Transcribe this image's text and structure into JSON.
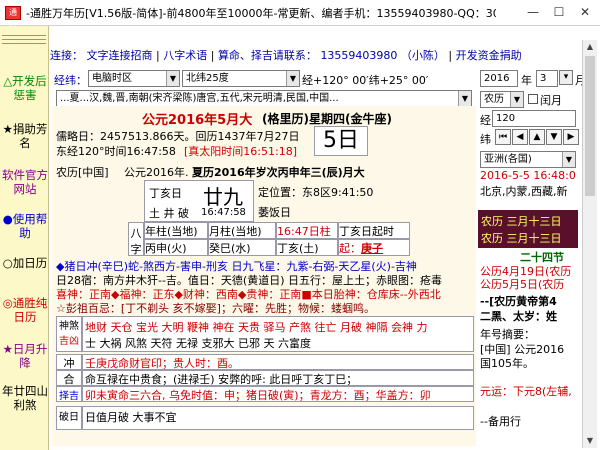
{
  "window": {
    "title": "-通胜万年历[V1.56版-简体]-前4800年至10000年-常更新、编者手机：13559403980-QQ：30...",
    "icon_text": "通胜",
    "min_label": "—",
    "max_label": "☐",
    "close_label": "✕"
  },
  "left_strip": {
    "items": [
      {
        "label": "△开发后惩害"
      },
      {
        "label": "★捐助芳名"
      },
      {
        "label": "软件官方网站"
      },
      {
        "label": "●使用帮助"
      },
      {
        "label": "○加日历"
      },
      {
        "label": "◎通胜纯日历"
      },
      {
        "label": "★日月升降"
      },
      {
        "label": "年廿四山利煞"
      }
    ]
  },
  "links": {
    "prefix": "连接：",
    "l1": "文字连接招商",
    "sep1": "|",
    "l2": "八字术语",
    "sep2": "|",
    "l3": "算命、择吉请联系：",
    "phone": "13559403980",
    "name": "（小陈）",
    "sep3": "|",
    "l4": "开发资金捐助"
  },
  "controls": {
    "jingwei_label": "经纬：",
    "timezone": "电脑时区",
    "lat": "北纬25度",
    "coords_text": "经+120° 00′纬+25° 00′",
    "dynasty": "...夏...汉,魏,晋,南朝(宋齐梁陈)唐宫,五代,宋元明清,民国,中国...",
    "year": "2016",
    "year_label": "年",
    "month": "3",
    "month_label": "月",
    "calendar_type": "农历",
    "leap_label": "闰月",
    "jing_label": "经",
    "jing_value": "120",
    "wei_label": "纬",
    "zone": "亚洲(各国)",
    "time_row": "2016-5-5 16:48:0",
    "location": "北京,内蒙,西藏,新"
  },
  "main": {
    "big_date": "公元2016年5月大",
    "weekday": "(格里历)星期四(金牛座)",
    "julian": "儒略日：2457513.866天。回历1437年7月27日",
    "true_solar": "东经120°时间16:47:58",
    "true_solar_red": "[真太阳时间16:51:18]",
    "day_num": "5日",
    "lunar_line_a": "农历[中国]",
    "lunar_line_b": "公元2016年.",
    "lunar_line_c": "夏历2016年岁次丙申年三(辰)月大",
    "day_gz": "丁亥日",
    "twenty_nine": "廿九",
    "tu_jing": "土 井 破",
    "time_small": "16:47:58",
    "fixed_dir": "定位置：东8区9:41:50",
    "mou_ri": "萎饭日",
    "bazi_label1": "八",
    "bazi_label2": "字",
    "year_pillar": "年柱(当地)",
    "month_pillar": "月柱(当地)",
    "hour_pillar": "16:47日柱",
    "day_pillar_start": "丁亥日起时",
    "bing_shen": "丙申(火)",
    "gui_si": "癸巳(水)",
    "ding_hai": "丁亥(土)",
    "qi_label": "起：",
    "geng_zi": "庚子",
    "sha_line": "◆猪日冲(辛巳)蛇-煞西方-害申-刑亥  日九飞星：九紫-右弼-天乙星(火)-吉神",
    "ri28": "日28宿：南方井木犴--吉。值日：天德(黄道日)  日五行：屋上土；赤眼图：疮毒",
    "xishen": "喜神：正南◆福神：正东◆财神：西南◆贵神：正南■本日胎神：仓库床--外西北",
    "pengzu": "☆彭祖百忌：[丁不剃头 亥不嫁娶]；六曜：先胜；物候：蝼蝈鸣。",
    "shen_sha_label1": "神煞",
    "shen_sha_label2": "吉凶",
    "shen_sha_1": "地财 天仓 宝光 大明 鞭神 神在 天贵 驿马 产煞 往亡 月破 神隔 会神 力",
    "shen_sha_2": "士 大祸 风煞 天符 无禄 支邪大 已邪 天 六富度",
    "chong_label": "冲",
    "chong": "壬庚戊命财官印；贵人时：酉。",
    "ke_label": "合",
    "ke": "命互禄在中贵食；(进禄壬)  安弊的呼: 此日呼丁亥丁巳；",
    "ze_label": "择吉",
    "ze": "卯未寅命三六合, 乌免时值：申；猪日破(寅)；青龙方：酉；华盖方：卯",
    "po_label": "破日",
    "po": "日值月破  大事不宜"
  },
  "right": {
    "line1": "农历 三月十三日",
    "line2": "农历 三月十三日",
    "solar_terms_title": "二十四节",
    "term1": "公历4月19日(农历",
    "term2": "公历5月5日(农历",
    "yellow_book": "--[农历黄帝第4",
    "er_hei": "二黑、太岁：姓",
    "annual_title": "年号摘要：",
    "annual_1": "[中国] 公元2016",
    "annual_2": "国105年。",
    "yuan_yun": "元运：下元8(左辅,",
    "bei_yong": "--备用行"
  },
  "colors": {
    "left_strip_bg": "#fdf8c8",
    "panel_bg": "#fdf8e8",
    "dark_band": "#5a0f2a",
    "accent_red": "#cc0000",
    "accent_blue": "#0000cc"
  }
}
